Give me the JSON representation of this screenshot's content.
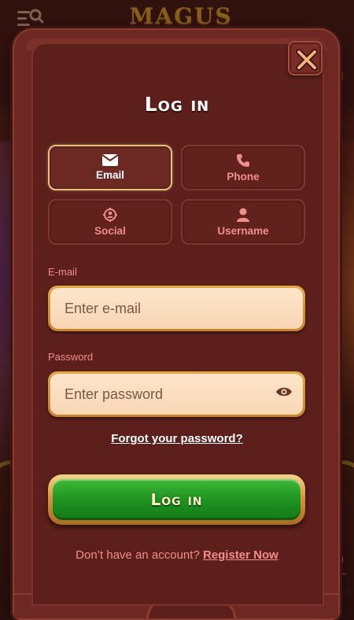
{
  "background": {
    "logo_text": "MAGUS"
  },
  "modal": {
    "title": "Log in",
    "close_icon": "close-x-icon",
    "methods": [
      {
        "label": "Email",
        "icon": "envelope-icon",
        "active": true
      },
      {
        "label": "Phone",
        "icon": "phone-icon",
        "active": false
      },
      {
        "label": "Social",
        "icon": "social-target-icon",
        "active": false
      },
      {
        "label": "Username",
        "icon": "user-icon",
        "active": false
      }
    ],
    "email_field": {
      "label": "E-mail",
      "placeholder": "Enter e-mail",
      "value": ""
    },
    "password_field": {
      "label": "Password",
      "placeholder": "Enter password",
      "value": "",
      "toggle_icon": "eye-icon"
    },
    "forgot_password": "Forgot your password?",
    "login_button": "Log in",
    "signup_prompt": "Don’t have an account?",
    "register_link": "Register Now"
  },
  "colors": {
    "modal_bg": "#5d1f1b",
    "accent_gold": "#e7c07e",
    "label_pink": "#f08d8d",
    "button_green": "#1f9421"
  }
}
